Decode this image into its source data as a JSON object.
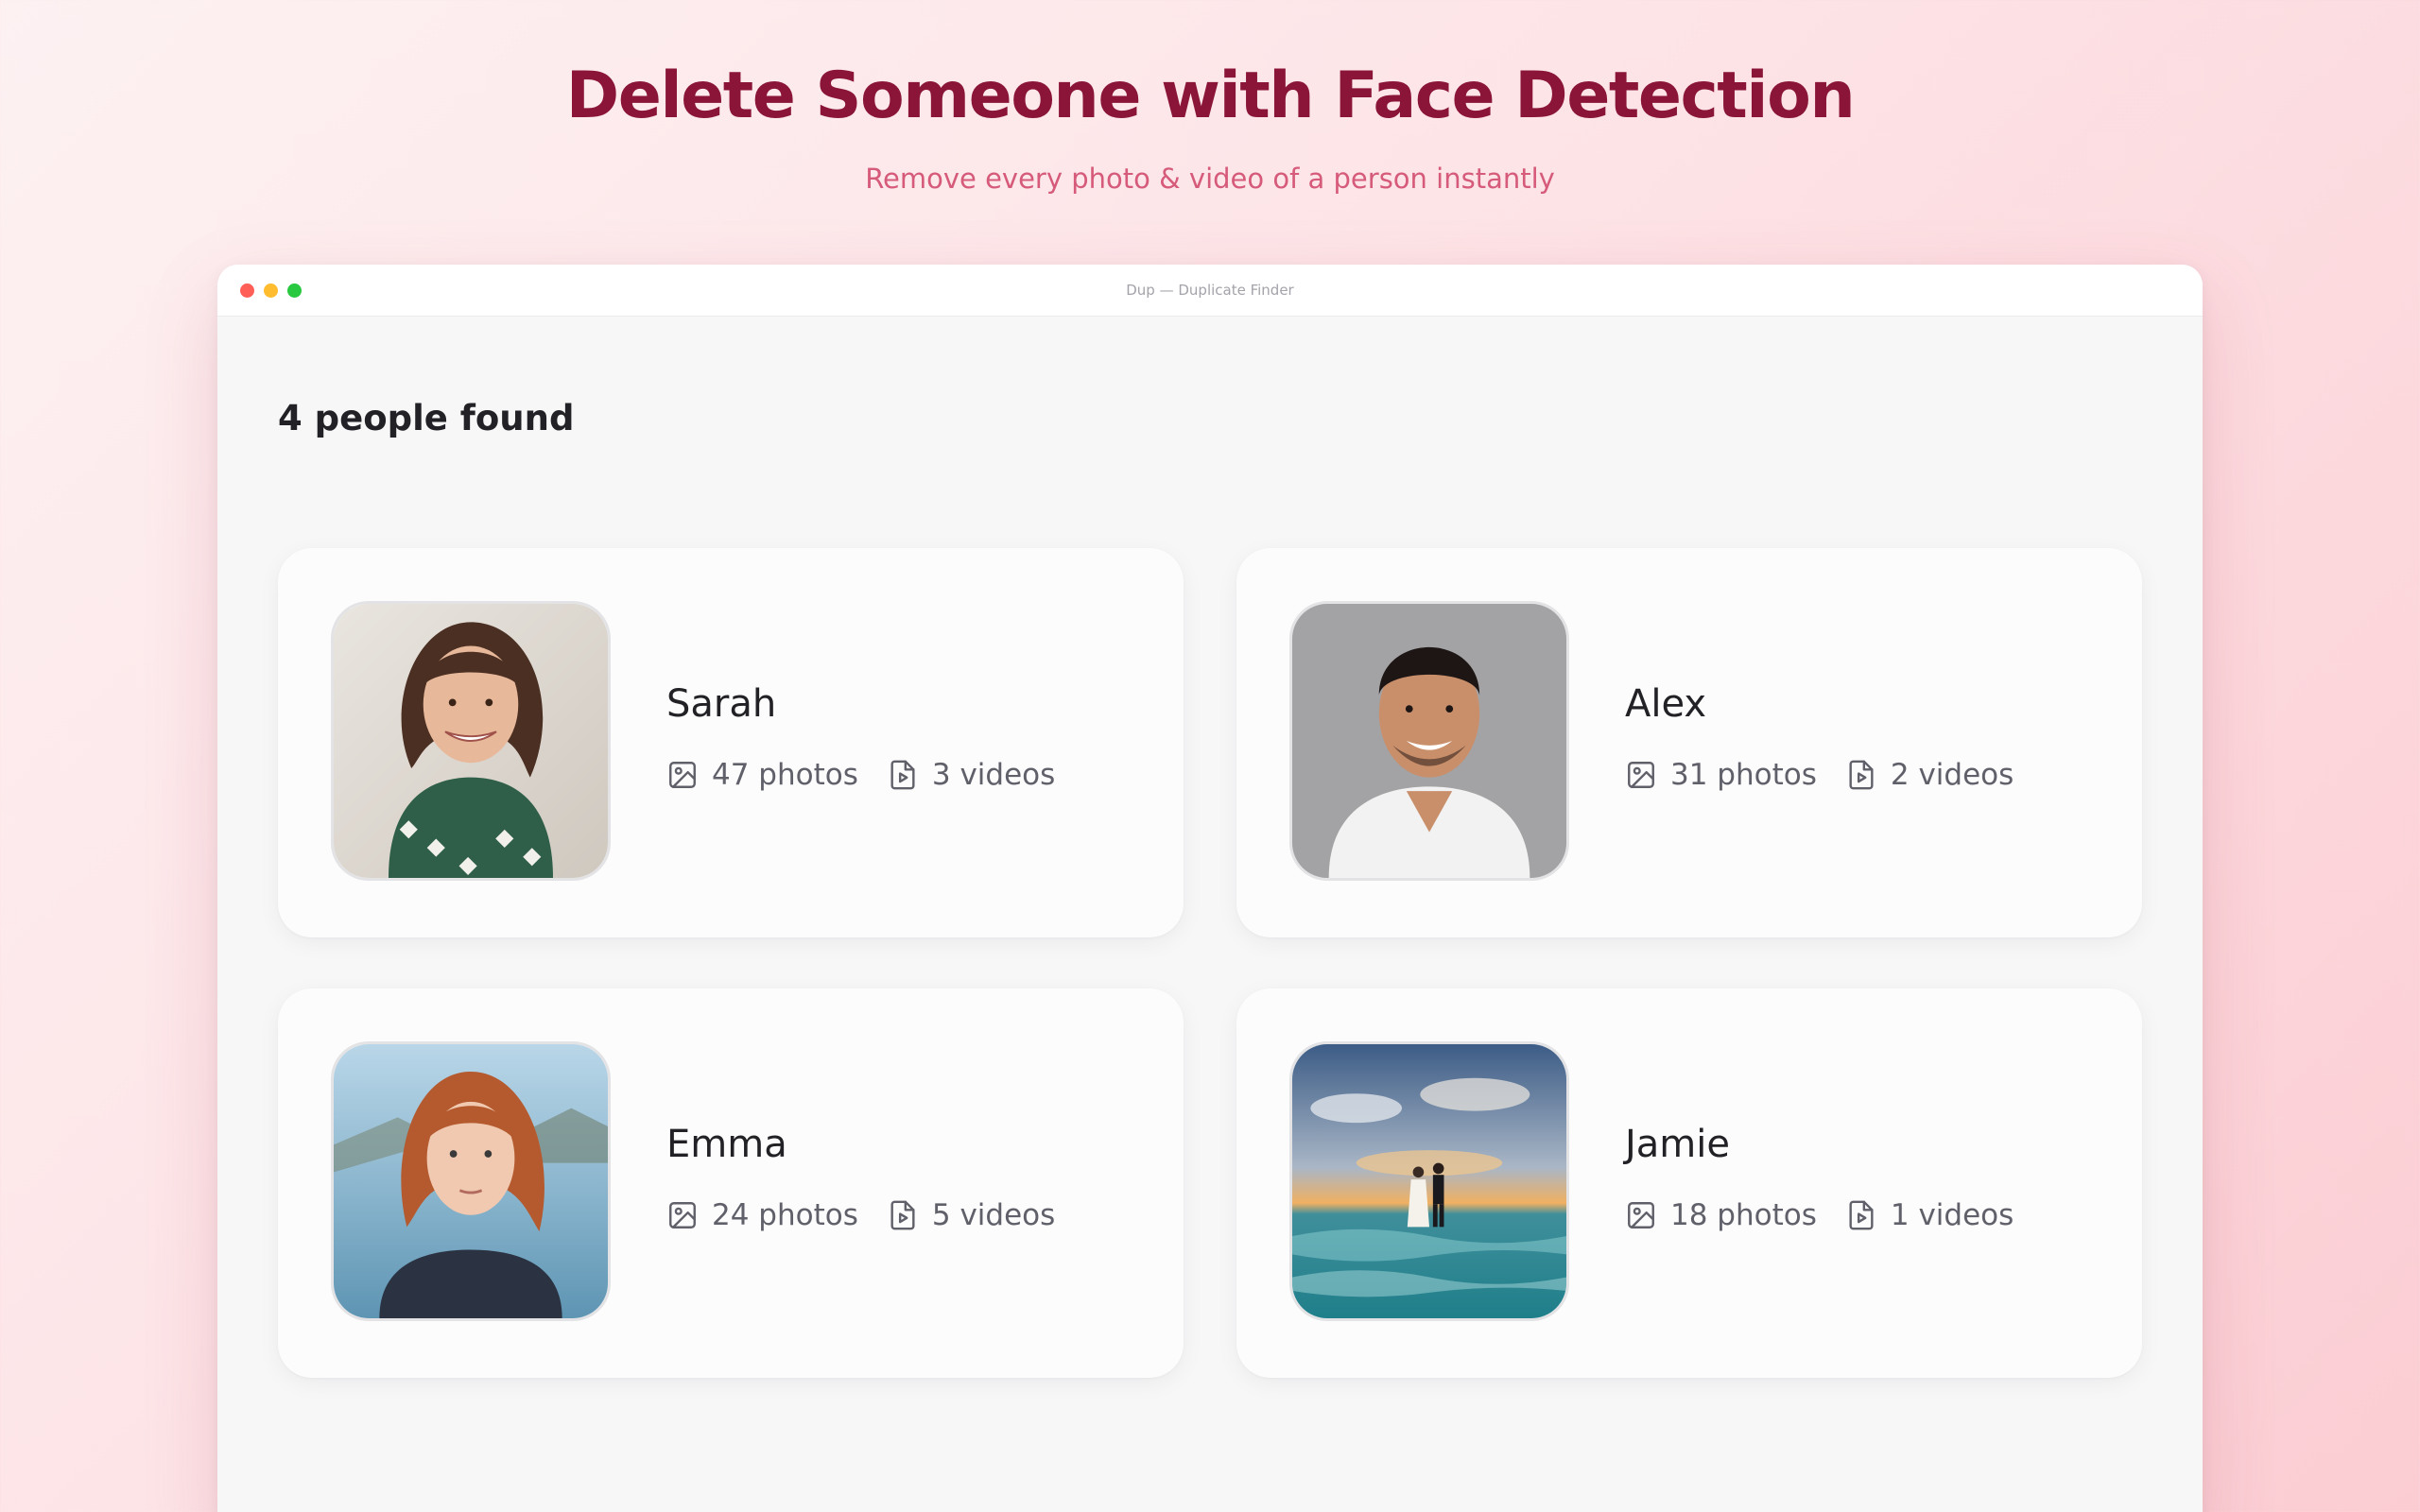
{
  "hero": {
    "title": "Delete Someone with Face Detection",
    "subtitle": "Remove every photo & video of a person instantly"
  },
  "window": {
    "title": "Dup — Duplicate Finder",
    "traffic_colors": [
      "#ff5f57",
      "#febc2e",
      "#28c840"
    ]
  },
  "main": {
    "heading": "4 people found",
    "people": [
      {
        "name": "Sarah",
        "photos": "47 photos",
        "videos": "3 videos",
        "avatar": "portrait-smiling-woman-curly-hair"
      },
      {
        "name": "Alex",
        "photos": "31 photos",
        "videos": "2 videos",
        "avatar": "portrait-smiling-man-white-tshirt"
      },
      {
        "name": "Emma",
        "photos": "24 photos",
        "videos": "5 videos",
        "avatar": "portrait-red-haired-woman-lake"
      },
      {
        "name": "Jamie",
        "photos": "18 photos",
        "videos": "1 videos",
        "avatar": "couple-walking-beach-sunset"
      }
    ]
  },
  "icons": {
    "photo": "image-icon",
    "video": "video-file-icon"
  },
  "colors": {
    "title": "#8a1538",
    "subtitle": "#d65a7a",
    "text": "#222226",
    "muted": "#60606a"
  }
}
